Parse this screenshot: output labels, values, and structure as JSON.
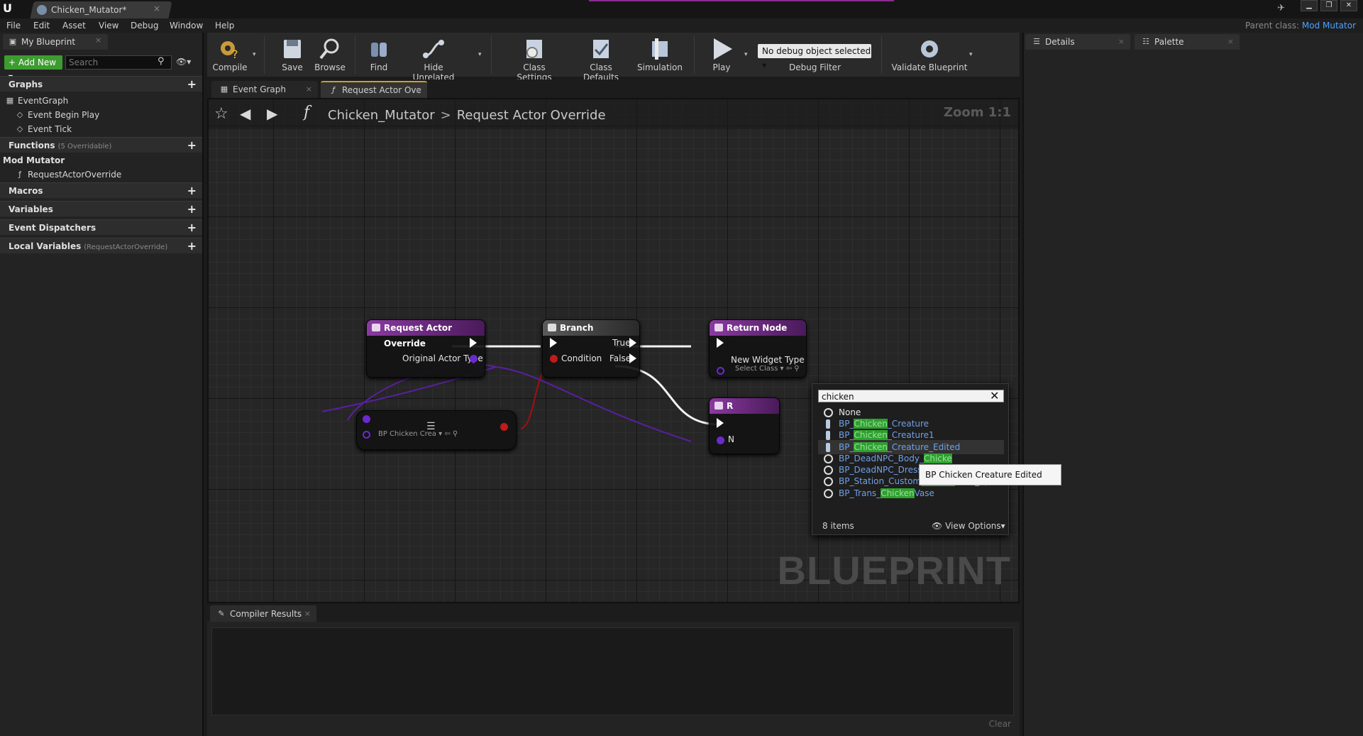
{
  "titlebar": {
    "tab_title": "Chicken_Mutator*",
    "close": "×",
    "controls": {
      "minimize": "▁",
      "restore": "❐",
      "close": "✕"
    }
  },
  "menubar": {
    "items": [
      "File",
      "Edit",
      "Asset",
      "View",
      "Debug",
      "Window",
      "Help"
    ],
    "parent_class_label": "Parent class:",
    "parent_class_value": "Mod Mutator"
  },
  "left_panel": {
    "tab_label": "My Blueprint",
    "add_new": "Add New",
    "search_placeholder": "Search",
    "sections": {
      "graphs": "Graphs",
      "functions": "Functions",
      "functions_sub": "(5 Overridable)",
      "macros": "Macros",
      "variables": "Variables",
      "dispatchers": "Event Dispatchers",
      "local_vars": "Local Variables",
      "local_vars_sub": "(RequestActorOverride)"
    },
    "graph_items": [
      "EventGraph",
      "Event Begin Play",
      "Event Tick"
    ],
    "mod_mutator_header": "Mod Mutator",
    "mod_mutator_items": [
      "RequestActorOverride"
    ]
  },
  "toolbar": {
    "compile": "Compile",
    "save": "Save",
    "browse": "Browse",
    "find": "Find",
    "hide_unrelated": "Hide Unrelated",
    "class_settings": "Class Settings",
    "class_defaults": "Class Defaults",
    "simulation": "Simulation",
    "play": "Play",
    "debug_object": "No debug object selected",
    "debug_filter": "Debug Filter",
    "validate": "Validate Blueprint"
  },
  "right_panel": {
    "details": "Details",
    "palette": "Palette"
  },
  "graph_tabs": {
    "event_graph": "Event Graph",
    "request_actor": "Request Actor Ove"
  },
  "breadcrumb": {
    "blueprint": "Chicken_Mutator",
    "separator": ">",
    "function": "Request Actor Override",
    "zoom": "Zoom 1:1",
    "watermark": "BLUEPRINT"
  },
  "nodes": {
    "request_actor_override": {
      "title": "Request Actor Override",
      "pin_out": "Original Actor Type"
    },
    "branch": {
      "title": "Branch",
      "condition": "Condition",
      "true": "True",
      "false": "False"
    },
    "return_node": {
      "title": "Return Node",
      "pin": "New Widget Type",
      "select": "Select Class"
    },
    "return_node_2": {
      "title": "R",
      "pin": "N"
    },
    "select_node": {
      "value": "BP Chicken Crea"
    }
  },
  "picker": {
    "search_value": "chicken",
    "clear": "✕",
    "options": [
      {
        "pre": "None",
        "hl": "",
        "post": ""
      },
      {
        "pre": "BP_",
        "hl": "Chicken",
        "post": "_Creature"
      },
      {
        "pre": "BP_",
        "hl": "Chicken",
        "post": "_Creature1"
      },
      {
        "pre": "BP_",
        "hl": "Chicken",
        "post": "_Creature_Edited"
      },
      {
        "pre": "BP_DeadNPC_Body_",
        "hl": "Chicke",
        "post": ""
      },
      {
        "pre": "BP_DeadNPC_Dressing_",
        "hl": "Ch",
        "post": ""
      },
      {
        "pre": "BP_Station_Custom",
        "hl": "Chicken",
        "post": "Feed_1p"
      },
      {
        "pre": "BP_Trans_",
        "hl": "Chicken",
        "post": "Vase"
      }
    ],
    "count": "8 items",
    "view_options": "View Options"
  },
  "tooltip": "BP Chicken Creature Edited",
  "compiler": {
    "tab": "Compiler Results",
    "clear": "Clear"
  },
  "colors": {
    "accent_purple": "#8a2c8f",
    "function_header": "#7b2f8f",
    "branch_header": "#3a3a3a",
    "wire_class": "#5a1fa3",
    "add_new_green": "#3d9c2f",
    "highlight_green": "#2ea02e",
    "link_blue": "#4aa3ff"
  }
}
